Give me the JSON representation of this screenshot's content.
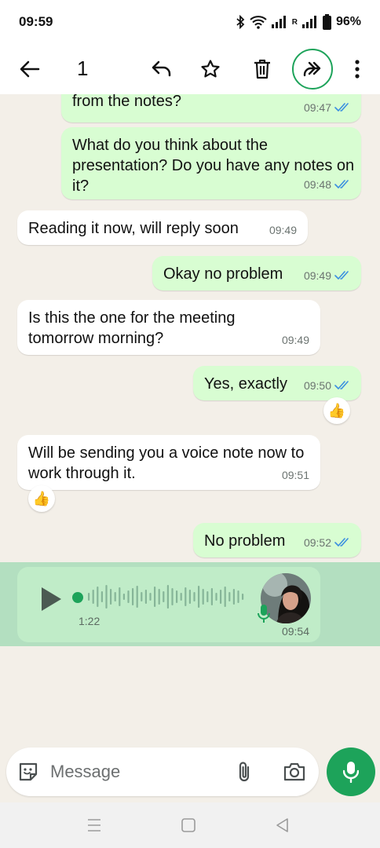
{
  "status_bar": {
    "time": "09:59",
    "battery": "96%",
    "roaming": "R",
    "icons": [
      "bluetooth-icon",
      "wifi-icon",
      "signal-icon",
      "signal-roaming-icon",
      "battery-icon"
    ]
  },
  "action_bar": {
    "selected_count": "1",
    "icons": [
      "back-arrow-icon",
      "reply-icon",
      "star-icon",
      "delete-icon",
      "forward-icon",
      "more-vert-icon"
    ]
  },
  "messages": [
    {
      "direction": "out",
      "text": "from the notes?",
      "time": "09:47",
      "status": "read"
    },
    {
      "direction": "out",
      "text": "What do you think about the presentation? Do you have any notes on it?",
      "time": "09:48",
      "status": "read"
    },
    {
      "direction": "in",
      "text": "Reading it now, will reply soon",
      "time": "09:49"
    },
    {
      "direction": "out",
      "text": "Okay no problem",
      "time": "09:49",
      "status": "read"
    },
    {
      "direction": "in",
      "text": "Is this the one for the meeting tomorrow morning?",
      "time": "09:49"
    },
    {
      "direction": "out",
      "text": "Yes, exactly",
      "time": "09:50",
      "status": "read",
      "reaction": "👍"
    },
    {
      "direction": "in",
      "text": "Will be sending you a voice note now to work through it.",
      "time": "09:51",
      "reaction": "👍"
    },
    {
      "direction": "out",
      "text": "No problem",
      "time": "09:52",
      "status": "read"
    }
  ],
  "voice_note": {
    "duration": "1:22",
    "time": "09:54",
    "selected": true,
    "progress": 0
  },
  "composer": {
    "placeholder": "Message",
    "value": ""
  },
  "colors": {
    "accent": "#1da35a",
    "outgoing_bubble": "#d8fdd2",
    "incoming_bubble": "#ffffff",
    "chat_background": "#f3efe8",
    "read_tick": "#3b8fe0",
    "selection": "#b3dfc0"
  }
}
